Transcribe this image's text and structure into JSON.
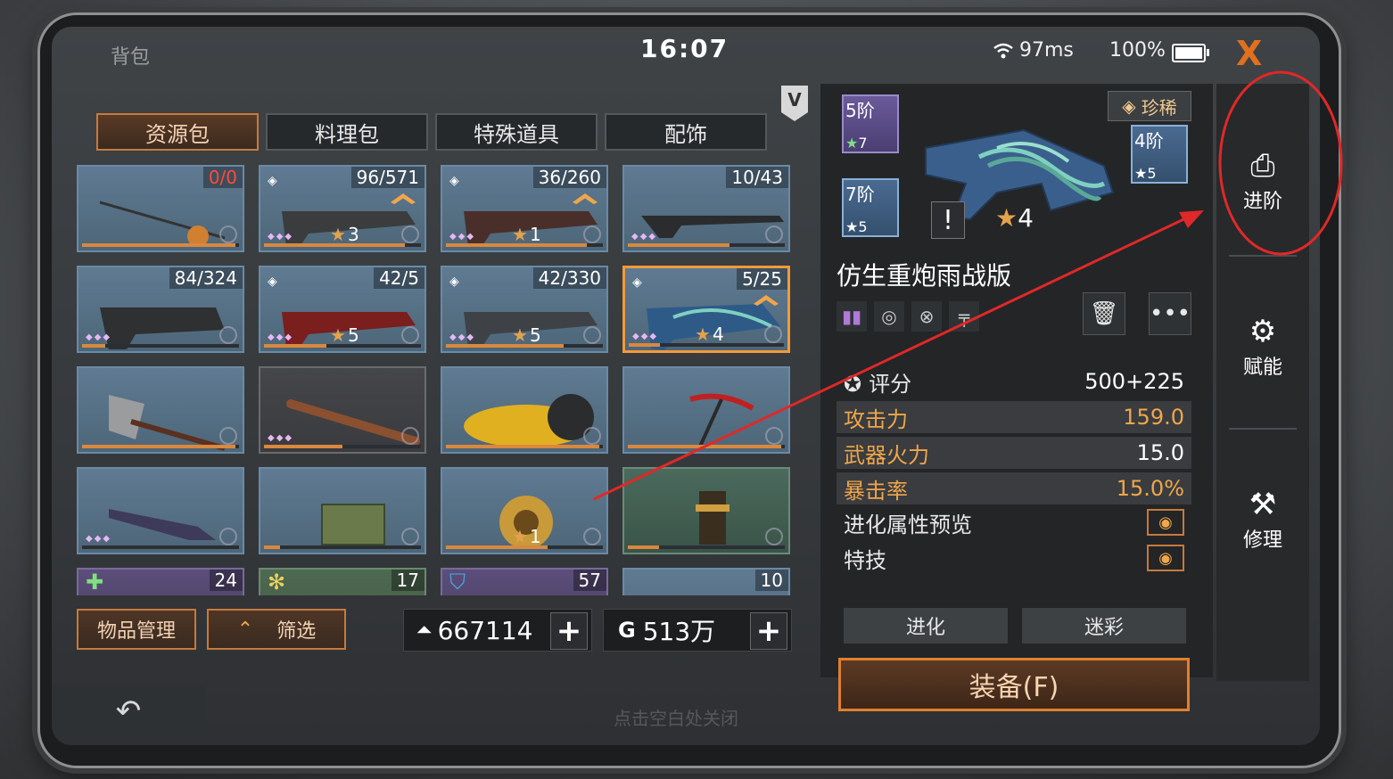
{
  "statusbar": {
    "title": "背包",
    "time": "16:07",
    "ping": "97ms",
    "battery": "100%",
    "close_icon": "X"
  },
  "tabs": [
    "资源包",
    "料理包",
    "特殊道具",
    "配饰"
  ],
  "vbadge": "V",
  "grid": [
    {
      "count": "0/0",
      "count_color": "red",
      "item": "fishing-rod",
      "progress": 0.98
    },
    {
      "count": "96/571",
      "item": "heavy-rifle",
      "stars": "3",
      "gem": true,
      "dots": "◆◆◆",
      "upgrade": true,
      "progress": 0.9
    },
    {
      "count": "36/260",
      "item": "flame-rifle",
      "stars": "1",
      "gem": true,
      "dots": "◆◆◆",
      "upgrade": true,
      "progress": 0.9
    },
    {
      "count": "10/43",
      "item": "sniper-rifle",
      "dots": "◆◆◆",
      "progress": 0.65
    },
    {
      "count": "84/324",
      "item": "black-launcher",
      "dots": "◆◆◆",
      "progress": 0.15
    },
    {
      "count": "42/5",
      "item": "red-rifle",
      "stars": "5",
      "gem": true,
      "dots": "◆◆◆",
      "progress": 0.4
    },
    {
      "count": "42/330",
      "item": "camo-rifle",
      "stars": "5",
      "gem": true,
      "dots": "◆◆◆",
      "progress": 0.75
    },
    {
      "count": "5/25",
      "item": "biotech-cannon",
      "stars": "4",
      "gem": true,
      "dots": "◆◆◆",
      "upgrade": true,
      "selected": true,
      "progress": 0.2
    },
    {
      "item": "axe",
      "progress": 0.98
    },
    {
      "item": "spiked-bat",
      "dots": "◆◆◆",
      "progress": 0.5,
      "dark": true
    },
    {
      "item": "yellow-vehicle",
      "progress": 0.98
    },
    {
      "item": "pickaxe",
      "progress": 0.98
    },
    {
      "item": "knife",
      "dots": "◆◆◆",
      "progress": 0.0
    },
    {
      "item": "ammo-crate",
      "progress": 0.1
    },
    {
      "item": "golden-armor",
      "stars": "1",
      "progress": 0.65
    },
    {
      "item": "totem",
      "progress": 0.2,
      "green": true
    },
    {
      "count": "24",
      "item": "heal-kit",
      "badge": "green-cross",
      "purple": true
    },
    {
      "count": "17",
      "item": "snow-item",
      "badge": "snowflake",
      "olive": true
    },
    {
      "count": "57",
      "item": "shield-item",
      "badge": "blue-shield",
      "purple": true
    },
    {
      "count": "10",
      "item": "bottle"
    }
  ],
  "bottom": {
    "manage_label": "物品管理",
    "filter_label": "筛选",
    "gold": "667114",
    "coins": "513万",
    "plus": "+"
  },
  "back_icon": "↶",
  "hint": "点击空白处关闭",
  "detail": {
    "rarity": "珍稀",
    "mods": [
      {
        "level": "5阶",
        "stars": "7"
      },
      {
        "level": "7阶",
        "stars": "5"
      },
      {
        "level": "4阶",
        "stars": "5"
      }
    ],
    "warn": "!",
    "stars": "4",
    "name": "仿生重炮雨战版",
    "tools": [
      "🗑",
      "•••"
    ],
    "score_label": "评分",
    "score_value": "500+225",
    "stats": [
      {
        "label": "攻击力",
        "value": "159.0"
      },
      {
        "label": "武器火力",
        "value": "15.0"
      },
      {
        "label": "暴击率",
        "value": "15.0%"
      }
    ],
    "preview_label": "进化属性预览",
    "skill_label": "特技",
    "evolve_label": "进化",
    "camo_label": "迷彩",
    "equip_label": "装备(F)"
  },
  "sidebar": [
    {
      "label": "进阶",
      "icon": "advance-icon"
    },
    {
      "label": "赋能",
      "icon": "empower-icon"
    },
    {
      "label": "修理",
      "icon": "repair-icon"
    }
  ]
}
